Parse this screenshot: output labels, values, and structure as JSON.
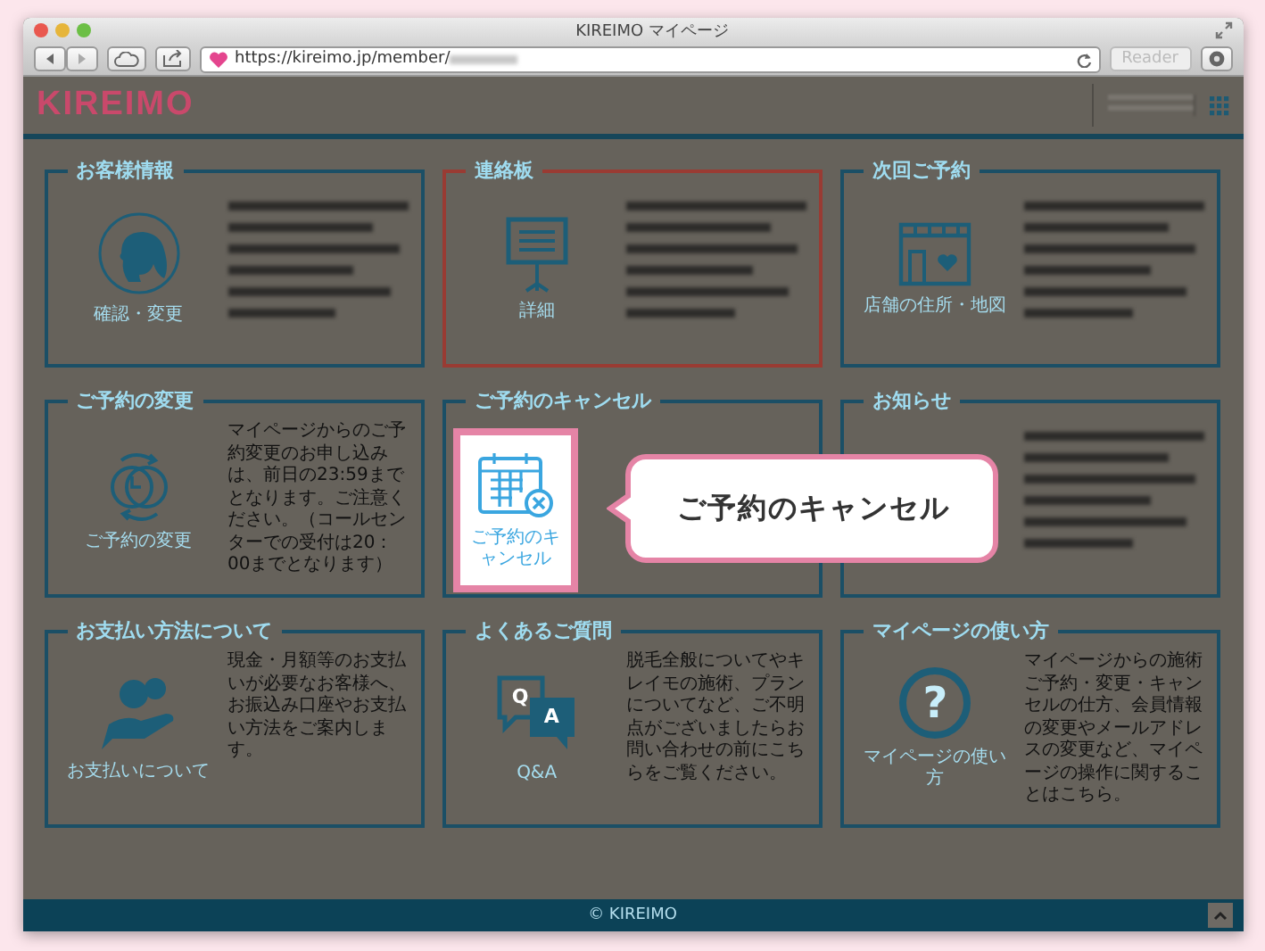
{
  "window": {
    "title": "KIREIMO マイページ",
    "url": "https://kireimo.jp/member/",
    "url_redacted": true,
    "reader_button": "Reader"
  },
  "header": {
    "logo": "KIREIMO",
    "account_redacted": true
  },
  "cards": [
    {
      "title": "お客様情報",
      "alert": false,
      "body_blurred": true,
      "link": "確認・変更"
    },
    {
      "title": "連絡板",
      "alert": true,
      "body_blurred": true,
      "link": "詳細"
    },
    {
      "title": "次回ご予約",
      "alert": false,
      "body_blurred": true,
      "link": "店舗の住所・地図"
    },
    {
      "title": "ご予約の変更",
      "alert": false,
      "body_blurred": false,
      "body": "マイページからのご予約変更のお申し込みは、前日の23:59までとなります。ご注意ください。（コールセンターでの受付は20：00までとなります）",
      "link": "ご予約の変更"
    },
    {
      "title": "ご予約のキャンセル",
      "alert": false,
      "body_blurred": false,
      "highlighted": true
    },
    {
      "title": "お知らせ",
      "alert": false,
      "body_blurred": true
    },
    {
      "title": "お支払い方法について",
      "alert": false,
      "body_blurred": false,
      "body": "現金・月額等のお支払いが必要なお客様へ、お振込み口座やお支払い方法をご案内します。",
      "link": "お支払いについて"
    },
    {
      "title": "よくあるご質問",
      "alert": false,
      "body_blurred": false,
      "body": "脱毛全般についてやキレイモの施術、プランについてなど、ご不明点がございましたらお問い合わせの前にこちらをご覧ください。",
      "link": "Q&A",
      "icon_letters": [
        "Q",
        "A"
      ]
    },
    {
      "title": "マイページの使い方",
      "alert": false,
      "body_blurred": false,
      "body": "マイページからの施術ご予約・変更・キャンセルの仕方、会員情報の変更やメールアドレスの変更など、マイページの操作に関することはこちら。",
      "link": "マイページの使い方",
      "icon_glyph": "?"
    }
  ],
  "highlight": {
    "label": "ご予約のキャンセル",
    "callout": "ご予約のキャンセル"
  },
  "footer": {
    "copyright": "© KIREIMO"
  }
}
